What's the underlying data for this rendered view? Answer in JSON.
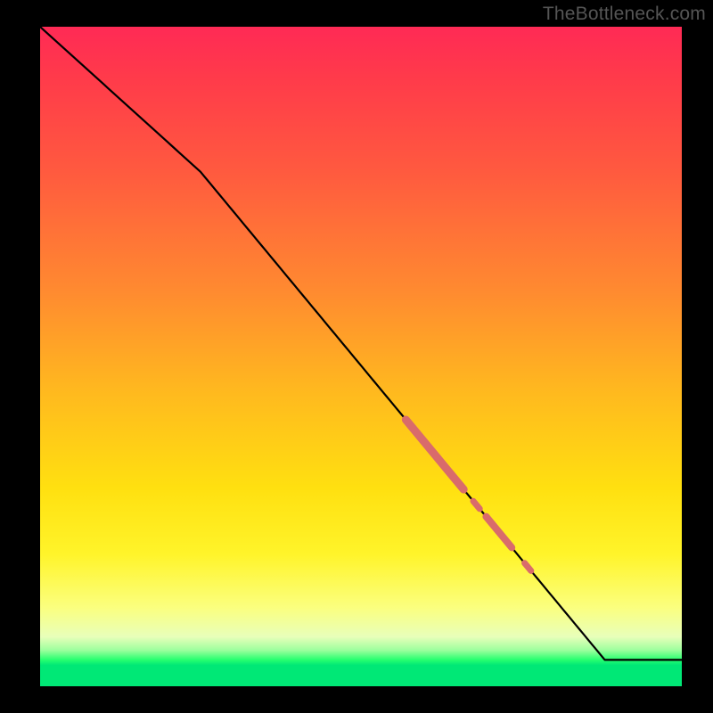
{
  "watermark": "TheBottleneck.com",
  "colors": {
    "gradient_top": "#ff2a55",
    "gradient_mid1": "#ff8a30",
    "gradient_mid2": "#ffe010",
    "gradient_low": "#fbff7e",
    "gradient_green": "#00e876",
    "curve": "#000000",
    "highlight": "#d96b6b",
    "frame": "#000000"
  },
  "chart_data": {
    "type": "line",
    "title": "",
    "xlabel": "",
    "ylabel": "",
    "xlim": [
      0,
      100
    ],
    "ylim": [
      0,
      100
    ],
    "grid": false,
    "series": [
      {
        "name": "curve",
        "x": [
          0,
          25,
          88,
          100
        ],
        "y": [
          100,
          78,
          4,
          4
        ],
        "note": "piecewise: steep drop 0–25, near-linear decline 25–88 (knee ~25), flat tail 88–100"
      }
    ],
    "highlight_segments": [
      {
        "name": "thick-upper",
        "x_start": 57,
        "x_end": 66,
        "width": 9
      },
      {
        "name": "dot-mid",
        "x_start": 67.5,
        "x_end": 68.5,
        "width": 7
      },
      {
        "name": "thick-lower",
        "x_start": 69.5,
        "x_end": 73.5,
        "width": 8
      },
      {
        "name": "dot-low",
        "x_start": 75.5,
        "x_end": 76.5,
        "width": 7
      }
    ],
    "legend": null
  }
}
